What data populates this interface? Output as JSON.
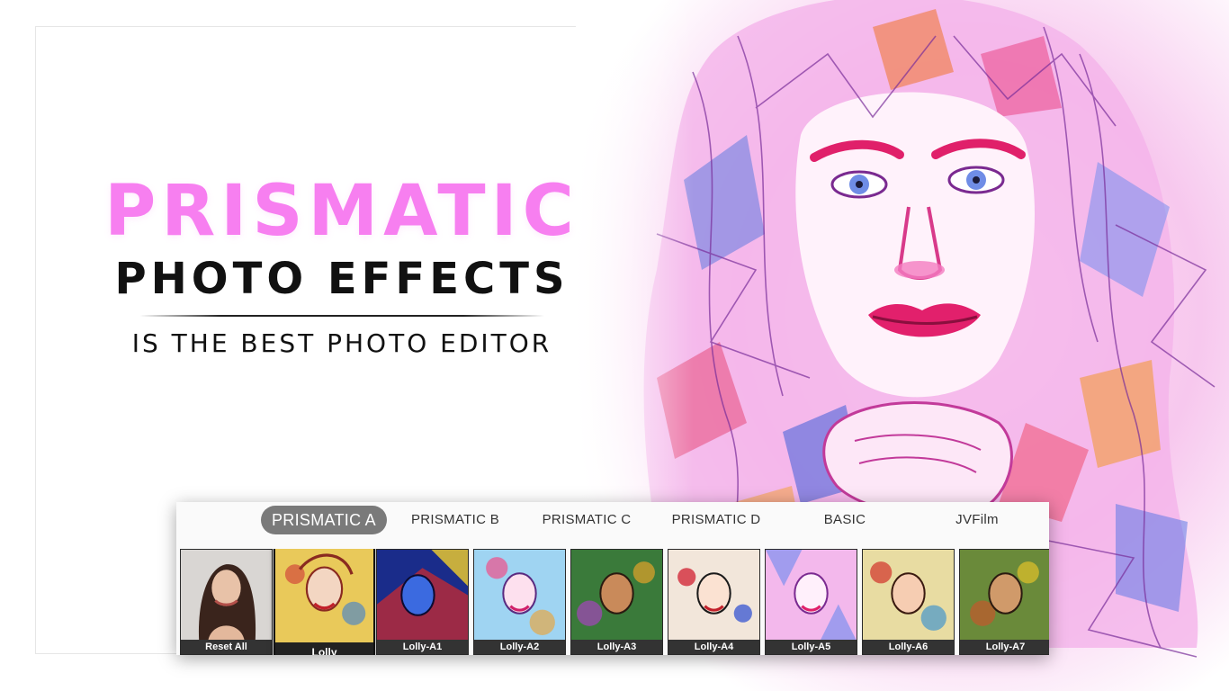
{
  "headline": {
    "title": "PRISMATIC",
    "subtitle": "PHOTO EFFECTS",
    "tagline": "IS THE BEST PHOTO EDITOR"
  },
  "colors": {
    "title": "#f77ff0",
    "active_tab": "#7a7a7a"
  },
  "tabs": [
    {
      "label": "PRISMATIC A",
      "active": true
    },
    {
      "label": "PRISMATIC B",
      "active": false
    },
    {
      "label": "PRISMATIC C",
      "active": false
    },
    {
      "label": "PRISMATIC D",
      "active": false
    },
    {
      "label": "BASIC",
      "active": false
    },
    {
      "label": "JVFilm",
      "active": false
    }
  ],
  "thumbnails": [
    {
      "label": "Reset All",
      "selected": false
    },
    {
      "label": "Lolly",
      "selected": true
    },
    {
      "label": "Lolly-A1",
      "selected": false
    },
    {
      "label": "Lolly-A2",
      "selected": false
    },
    {
      "label": "Lolly-A3",
      "selected": false
    },
    {
      "label": "Lolly-A4",
      "selected": false
    },
    {
      "label": "Lolly-A5",
      "selected": false
    },
    {
      "label": "Lolly-A6",
      "selected": false
    },
    {
      "label": "Lolly-A7",
      "selected": false
    }
  ]
}
